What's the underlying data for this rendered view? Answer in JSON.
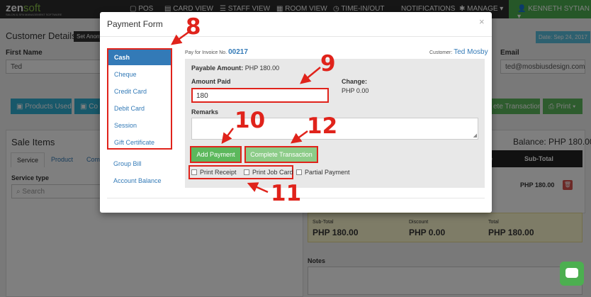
{
  "app": {
    "logo_main": "zen",
    "logo_accent": "soft",
    "logo_tagline": "SALON & SPA MANAGEMENT SOFTWARE",
    "nav": [
      "POS",
      "CARD VIEW",
      "STAFF VIEW",
      "ROOM VIEW",
      "TIME-IN/OUT",
      "NOTIFICATIONS",
      "MANAGE"
    ],
    "user": "KENNETH SYTIAN",
    "page_title": "Customer Details",
    "anon_button": "Set Anonym",
    "date_badge": "Date: Sep 24, 2017",
    "first_name_label": "First Name",
    "first_name_value": "Ted",
    "email_label": "Email",
    "email_value": "ted@mosbiusdesign.com",
    "products_used_button": "Products Used",
    "partial_button": "Co",
    "complete_transaction_bg": "ete Transaction",
    "print_button": "Print",
    "sale_items_title": "Sale Items",
    "tabs": [
      "Service",
      "Product",
      "Com"
    ],
    "service_type_label": "Service type",
    "search_placeholder": "Search",
    "balance": "Balance: PHP 180.00",
    "table_col_partial": "e",
    "table_col_subtotal": "Sub-Total",
    "row_amount": "PHP 180.00",
    "totals": [
      {
        "label": "Sub-Total",
        "value": "PHP 180.00"
      },
      {
        "label": "Discount",
        "value": "PHP 0.00"
      },
      {
        "label": "Total",
        "value": "PHP 180.00"
      }
    ],
    "notes_label": "Notes"
  },
  "modal": {
    "title": "Payment Form",
    "close": "×",
    "payment_methods": [
      "Cash",
      "Cheque",
      "Credit Card",
      "Debit Card",
      "Session",
      "Gift Certificate"
    ],
    "other_methods": [
      "Group Bill",
      "Account Balance"
    ],
    "invoice_label": "Pay for Invoice No.",
    "invoice_number": "00217",
    "customer_label": "Customer:",
    "customer_name": "Ted Mosby",
    "payable_label": "Payable Amount:",
    "payable_value": "PHP 180.00",
    "amount_paid_label": "Amount Paid",
    "amount_paid_value": "180",
    "change_label": "Change:",
    "change_value": "PHP 0.00",
    "remarks_label": "Remarks",
    "add_payment_button": "Add Payment",
    "complete_transaction_button": "Complete Transaction",
    "checkboxes": [
      "Print Receipt",
      "Print Job Card",
      "Partial Payment"
    ]
  },
  "annotations": [
    "8",
    "9",
    "10",
    "11",
    "12"
  ],
  "colors": {
    "annotation_red": "#e0231b",
    "primary_blue": "#337ab7",
    "success_green": "#5cb85c",
    "topbar": "#2d2d2d"
  }
}
